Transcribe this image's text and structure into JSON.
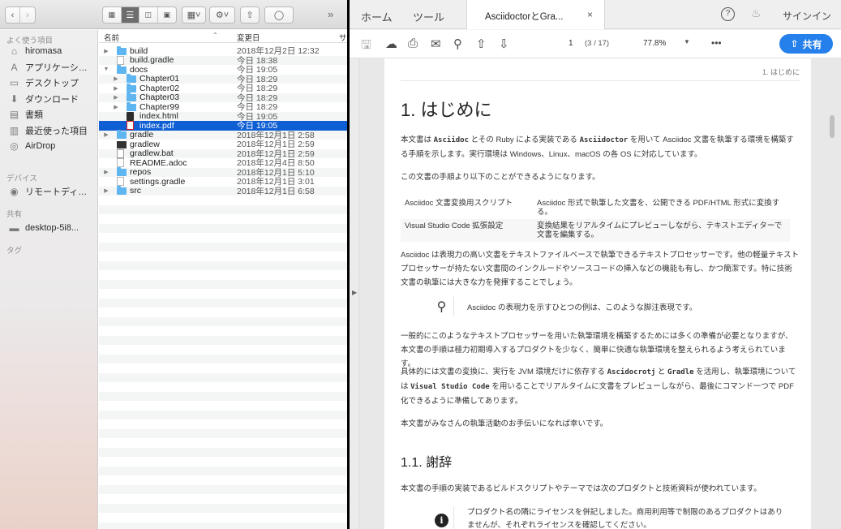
{
  "finder": {
    "sidebar": {
      "sections": {
        "favorites": "よく使う項目",
        "devices": "デバイス",
        "shared": "共有",
        "tags": "タグ"
      },
      "favorites": [
        {
          "label": "hiromasa",
          "icon": "home-icon"
        },
        {
          "label": "アプリケーシ…",
          "icon": "applications-icon"
        },
        {
          "label": "デスクトップ",
          "icon": "desktop-icon"
        },
        {
          "label": "ダウンロード",
          "icon": "download-icon"
        },
        {
          "label": "書類",
          "icon": "documents-icon"
        },
        {
          "label": "最近使った項目",
          "icon": "recents-icon"
        },
        {
          "label": "AirDrop",
          "icon": "airdrop-icon"
        }
      ],
      "devices": [
        {
          "label": "リモートディ…",
          "icon": "remote-disc-icon"
        }
      ],
      "shared": [
        {
          "label": "desktop-5i8...",
          "icon": "computer-icon"
        }
      ]
    },
    "columns": {
      "name": "名前",
      "modified": "変更日",
      "size": "サ"
    },
    "files": [
      {
        "name": "build",
        "date": "2018年12月2日 12:32",
        "kind": "folder",
        "level": 0,
        "disclosure": "closed"
      },
      {
        "name": "build.gradle",
        "date": "今日 18:38",
        "kind": "doc",
        "level": 0,
        "disclosure": "none"
      },
      {
        "name": "docs",
        "date": "今日 19:05",
        "kind": "folder",
        "level": 0,
        "disclosure": "open"
      },
      {
        "name": "Chapter01",
        "date": "今日 18:29",
        "kind": "folder",
        "level": 1,
        "disclosure": "closed"
      },
      {
        "name": "Chapter02",
        "date": "今日 18:29",
        "kind": "folder",
        "level": 1,
        "disclosure": "closed"
      },
      {
        "name": "Chapter03",
        "date": "今日 18:29",
        "kind": "folder",
        "level": 1,
        "disclosure": "closed"
      },
      {
        "name": "Chapter99",
        "date": "今日 18:29",
        "kind": "folder",
        "level": 1,
        "disclosure": "closed"
      },
      {
        "name": "index.html",
        "date": "今日 19:05",
        "kind": "html",
        "level": 1,
        "disclosure": "none"
      },
      {
        "name": "index.pdf",
        "date": "今日 19:05",
        "kind": "pdf",
        "level": 1,
        "disclosure": "none",
        "selected": true
      },
      {
        "name": "gradle",
        "date": "2018年12月1日 2:58",
        "kind": "folder",
        "level": 0,
        "disclosure": "closed"
      },
      {
        "name": "gradlew",
        "date": "2018年12月1日 2:59",
        "kind": "exec",
        "level": 0,
        "disclosure": "none"
      },
      {
        "name": "gradlew.bat",
        "date": "2018年12月1日 2:59",
        "kind": "bat",
        "level": 0,
        "disclosure": "none"
      },
      {
        "name": "README.adoc",
        "date": "2018年12月4日 8:50",
        "kind": "doc",
        "level": 0,
        "disclosure": "none"
      },
      {
        "name": "repos",
        "date": "2018年12月1日 5:10",
        "kind": "folder",
        "level": 0,
        "disclosure": "closed"
      },
      {
        "name": "settings.gradle",
        "date": "2018年12月1日 3:01",
        "kind": "doc",
        "level": 0,
        "disclosure": "none"
      },
      {
        "name": "src",
        "date": "2018年12月1日 6:58",
        "kind": "folder",
        "level": 0,
        "disclosure": "closed"
      }
    ],
    "colors": {
      "selection": "#0f5fd4",
      "folder": "#5fb5f0"
    }
  },
  "acrobat": {
    "tabs": {
      "home": "ホーム",
      "tools": "ツール",
      "document": "AsciidoctorとGra...",
      "close": "×"
    },
    "header_right": {
      "help": "?",
      "bell": "bell-icon",
      "signin": "サインイン"
    },
    "toolbar": {
      "page_current": "1",
      "page_count": "(3 / 17)",
      "zoom": "77.8%",
      "more": "•••",
      "share": "共有"
    },
    "colors": {
      "accent": "#2680eb"
    },
    "page": {
      "running_head": "1. はじめに",
      "h1": "1. はじめに",
      "intro_1a": "本文書は ",
      "intro_code1": "Asciidoc",
      "intro_1b": " とその Ruby による実装である ",
      "intro_code2": "Asciidoctor",
      "intro_1c": " を用いて Asciidoc 文書を執筆する環境を構築する手順を示します。実行環境は Windows、Linux、macOS の各 OS に対応しています。",
      "intro_2": "この文書の手順より以下のことができるようになります。",
      "table": [
        [
          "Asciidoc 文書変換用スクリプト",
          "Asciidoc 形式で執筆した文書を、公開できる PDF/HTML 形式に変換する。"
        ],
        [
          "Visual Studio Code 拡張設定",
          "変換結果をリアルタイムにプレビューしながら、テキストエディターで文書を編集する。"
        ]
      ],
      "para_3": "Asciidoc は表現力の高い文書をテキストファイルベースで執筆できるテキストプロセッサーです。他の軽量テキストプロセッサーが持たない文書間のインクルードやソースコードの挿入などの機能も有し、かつ簡潔です。特に技術文書の執筆には大きな力を発揮することでしょう。",
      "tip": "Asciidoc の表現力を示すひとつの例は、このような脚注表現です。",
      "para_4": "一般的にこのようなテキストプロセッサーを用いた執筆環境を構築するためには多くの準備が必要となりますが、本文書の手順は極力初期導入するプロダクトを少なく、簡単に快適な執筆環境を整えられるよう考えられています。",
      "para_5a": "具体的には文書の変換に、実行を JVM 環境だけに依存する ",
      "para_5_code1": "Ascidocrotj",
      "para_5b": " と ",
      "para_5_code2": "Gradle",
      "para_5c": " を活用し、執筆環境については ",
      "para_5_code3": "Visual Studio Code",
      "para_5d": " を用いることでリアルタイムに文書をプレビューしながら、最後にコマンド一つで PDF 化できるように準備してあります。",
      "para_6": "本文書がみなさんの執筆活動のお手伝いになれば幸いです。",
      "h2": "1.1. 謝辞",
      "para_7": "本文書の手順の実装であるビルドスクリプトやテーマでは次のプロダクトと技術資料が使われています。",
      "note": "プロダクト名の隣にライセンスを併記しました。商用利用等で制限のあるプロダクトはありませんが、それぞれライセンスを確認してください。"
    }
  }
}
